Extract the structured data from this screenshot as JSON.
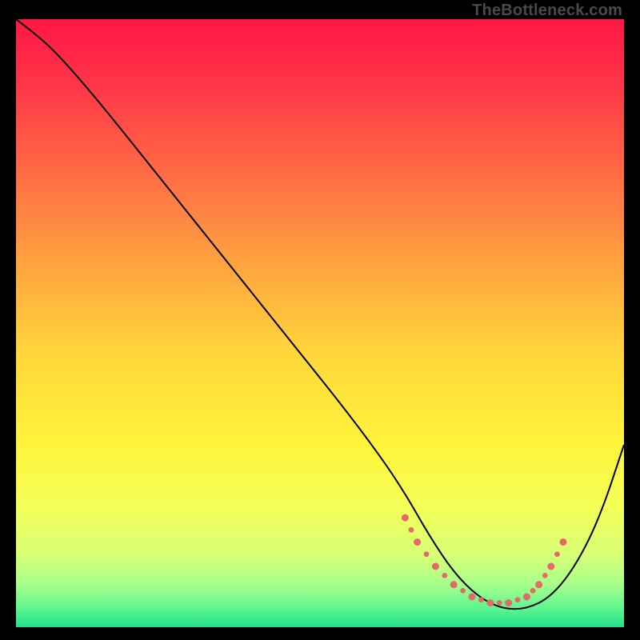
{
  "watermark": "TheBottleneck.com",
  "chart_data": {
    "type": "line",
    "title": "",
    "xlabel": "",
    "ylabel": "",
    "xlim": [
      0,
      100
    ],
    "ylim": [
      0,
      100
    ],
    "grid": false,
    "background_gradient": {
      "stops": [
        {
          "offset": 0.0,
          "color": "#ff1744"
        },
        {
          "offset": 0.1,
          "color": "#ff3348"
        },
        {
          "offset": 0.25,
          "color": "#ff6a45"
        },
        {
          "offset": 0.4,
          "color": "#ffa23f"
        },
        {
          "offset": 0.55,
          "color": "#ffd63a"
        },
        {
          "offset": 0.7,
          "color": "#fff43b"
        },
        {
          "offset": 0.8,
          "color": "#f4ff56"
        },
        {
          "offset": 0.88,
          "color": "#d8ff74"
        },
        {
          "offset": 0.93,
          "color": "#a6ff8a"
        },
        {
          "offset": 0.97,
          "color": "#5cf48f"
        },
        {
          "offset": 1.0,
          "color": "#22e08a"
        }
      ]
    },
    "series": [
      {
        "name": "bottleneck-curve",
        "stroke": "#000000",
        "stroke_width": 2,
        "x": [
          0,
          4,
          8,
          14,
          22,
          30,
          38,
          46,
          54,
          60,
          64,
          68,
          72,
          76,
          80,
          84,
          88,
          92,
          96,
          100
        ],
        "y": [
          100,
          97,
          93,
          86,
          76,
          66,
          56,
          46,
          36,
          28,
          22,
          15,
          9,
          5,
          3,
          3,
          5,
          10,
          18,
          30
        ]
      }
    ],
    "dotted_segment": {
      "name": "optimal-range",
      "stroke": "#e46a6a",
      "dot_radius": 4.5,
      "x": [
        64,
        66,
        69,
        72,
        75,
        78,
        81,
        84,
        86,
        88,
        90
      ],
      "y": [
        18,
        14,
        10,
        7,
        5,
        4,
        4,
        5,
        7,
        10,
        14
      ]
    }
  }
}
